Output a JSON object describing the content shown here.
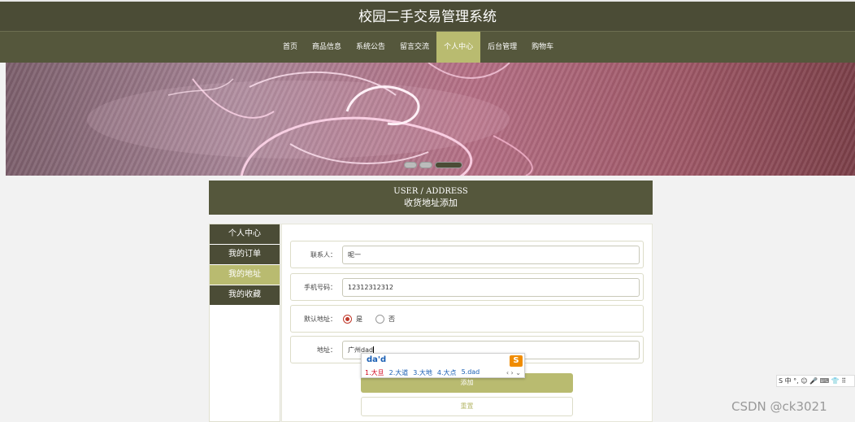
{
  "site_title": "校园二手交易管理系统",
  "nav": [
    {
      "label": "首页"
    },
    {
      "label": "商品信息"
    },
    {
      "label": "系统公告"
    },
    {
      "label": "留言交流"
    },
    {
      "label": "个人中心",
      "active": true
    },
    {
      "label": "后台管理"
    },
    {
      "label": "购物车"
    }
  ],
  "banner": {
    "slide_count": 3,
    "active_slide": 3
  },
  "section": {
    "title_en": "USER / ADDRESS",
    "title_cn": "收货地址添加"
  },
  "sidebar": [
    {
      "label": "个人中心"
    },
    {
      "label": "我的订单"
    },
    {
      "label": "我的地址",
      "active": true
    },
    {
      "label": "我的收藏"
    }
  ],
  "form": {
    "contact_label": "联系人：",
    "contact_value": "呢一",
    "phone_label": "手机号码：",
    "phone_value": "12312312312",
    "default_label": "默认地址：",
    "default_yes": "是",
    "default_no": "否",
    "address_label": "地址：",
    "address_value": "广州dad"
  },
  "buttons": {
    "add": "添加",
    "reset": "重置"
  },
  "ime": {
    "composition": "da'd",
    "candidates": [
      "1.大旦",
      "2.大道",
      "3.大地",
      "4.大点",
      "5.dad"
    ],
    "arrows": "‹ › ⌄"
  },
  "ime_toolbar": {
    "label": "S 中 °, ☺ 🎤 ⌨ 👕 ⠿"
  },
  "watermark": "CSDN @ck3021",
  "colors": {
    "dark_olive": "#55573c",
    "accent": "#b9bb70"
  }
}
